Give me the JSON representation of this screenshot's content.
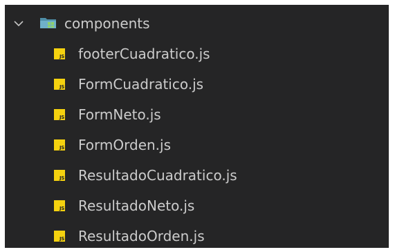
{
  "explorer": {
    "folder": {
      "name": "components",
      "icon": "folder-components-icon",
      "expanded": true,
      "chevron_icon": "chevron-down-icon",
      "icon_color": "#8fd16a"
    },
    "file_icon": {
      "text": "JS",
      "color": "#f5d20f"
    },
    "files": [
      {
        "name": "footerCuadratico.js"
      },
      {
        "name": "FormCuadratico.js"
      },
      {
        "name": "FormNeto.js"
      },
      {
        "name": "FormOrden.js"
      },
      {
        "name": "ResultadoCuadratico.js"
      },
      {
        "name": "ResultadoNeto.js"
      },
      {
        "name": "ResultadoOrden.js"
      }
    ]
  }
}
